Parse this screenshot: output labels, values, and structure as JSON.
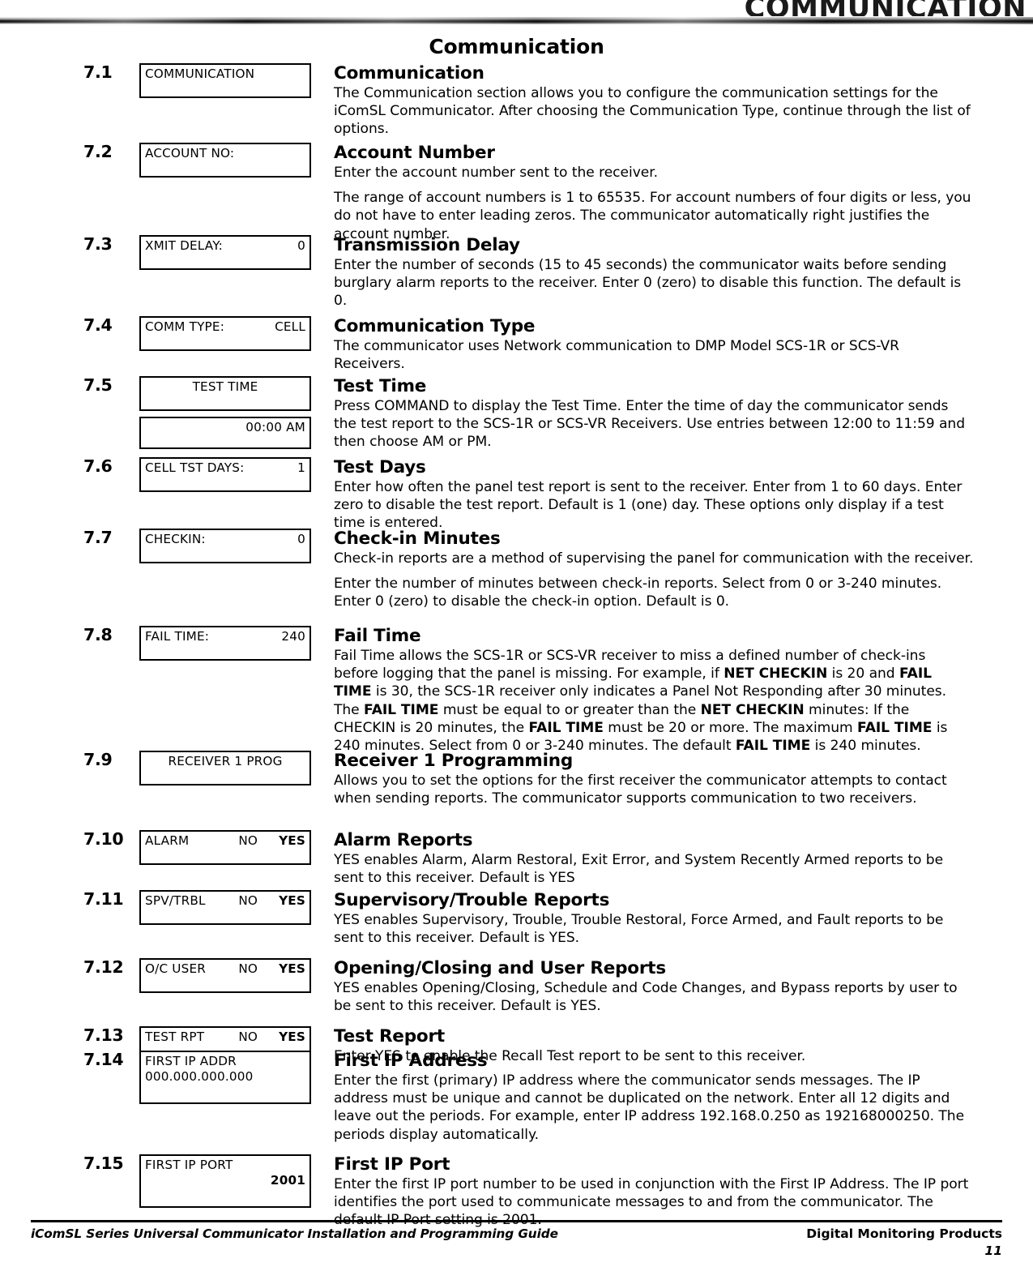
{
  "header": {
    "banner_title": "COMMUNICATION",
    "page_title": "Communication"
  },
  "sections": [
    {
      "number": "7.1",
      "heading": "Communication",
      "lcd": {
        "lines": [
          {
            "align": "left",
            "left": "COMMUNICATION",
            "right": ""
          }
        ]
      },
      "paragraphs": [
        "The Communication section allows you to configure the communication settings for the iComSL Communicator. After choosing the Communication Type, continue through the list of options."
      ]
    },
    {
      "number": "7.2",
      "heading": "Account Number",
      "lcd": {
        "lines": [
          {
            "align": "left",
            "left": "ACCOUNT NO:",
            "right": ""
          }
        ]
      },
      "paragraphs": [
        "Enter the account number sent to the receiver.",
        "The range of account numbers is 1 to 65535. For account numbers of four digits or less, you do not have to enter leading zeros. The communicator automatically right justifies the account number."
      ]
    },
    {
      "number": "7.3",
      "heading": "Transmission Delay",
      "lcd": {
        "lines": [
          {
            "align": "split",
            "left": "XMIT DELAY:",
            "right": "0"
          }
        ]
      },
      "paragraphs": [
        "Enter the number of seconds (15 to 45 seconds) the communicator waits before sending burglary alarm reports to the receiver. Enter 0 (zero) to disable this function. The default is 0."
      ]
    },
    {
      "number": "7.4",
      "heading": "Communication Type",
      "lcd": {
        "lines": [
          {
            "align": "split",
            "left": "COMM TYPE:",
            "right": "CELL"
          }
        ]
      },
      "paragraphs": [
        "The communicator uses Network communication to DMP Model SCS-1R or SCS-VR Receivers."
      ]
    },
    {
      "number": "7.5",
      "heading": "Test Time",
      "lcd": {
        "lines": [
          {
            "align": "center",
            "left": "TEST TIME",
            "right": ""
          }
        ]
      },
      "lcd2": {
        "lines": [
          {
            "align": "right",
            "left": "",
            "right": "00:00 AM"
          }
        ]
      },
      "paragraphs": [
        "Press COMMAND to display the Test Time. Enter the time of day the communicator sends the test report to the SCS-1R or SCS-VR Receivers. Use entries between 12:00 to 11:59 and then choose AM or PM."
      ]
    },
    {
      "number": "7.6",
      "heading": "Test Days",
      "lcd": {
        "lines": [
          {
            "align": "split",
            "left": "CELL TST DAYS:",
            "right": "1"
          }
        ]
      },
      "paragraphs": [
        "Enter how often the panel test report is sent to the receiver. Enter from 1 to 60 days. Enter zero to disable the test report. Default is 1 (one) day. These options only display if a test time is entered."
      ]
    },
    {
      "number": "7.7",
      "heading": "Check-in Minutes",
      "lcd": {
        "lines": [
          {
            "align": "split",
            "left": "CHECKIN:",
            "right": "0"
          }
        ]
      },
      "paragraphs": [
        "Check-in reports are a method of supervising the panel for communication with the receiver.",
        "Enter the number of minutes between check-in reports. Select from 0 or 3-240 minutes. Enter 0 (zero) to disable the check-in option. Default is 0."
      ]
    },
    {
      "number": "7.8",
      "heading": "Fail Time",
      "lcd": {
        "lines": [
          {
            "align": "split",
            "left": "FAIL TIME:",
            "right": "240"
          }
        ]
      },
      "paragraphs_rich": [
        [
          {
            "t": "Fail Time allows the SCS-1R or SCS-VR receiver to miss a defined number of check-ins before logging that the panel is missing. For example, if ",
            "b": false
          },
          {
            "t": "NET CHECKIN",
            "b": true
          },
          {
            "t": " is 20 and ",
            "b": false
          },
          {
            "t": "FAIL TIME",
            "b": true
          },
          {
            "t": " is 30, the SCS-1R receiver only indicates a Panel Not Responding after 30 minutes. The ",
            "b": false
          },
          {
            "t": "FAIL TIME",
            "b": true
          },
          {
            "t": " must be equal to or greater than the ",
            "b": false
          },
          {
            "t": "NET CHECKIN",
            "b": true
          },
          {
            "t": " minutes: If the CHECKIN is 20 minutes, the ",
            "b": false
          },
          {
            "t": "FAIL TIME",
            "b": true
          },
          {
            "t": " must be 20 or more. The maximum ",
            "b": false
          },
          {
            "t": "FAIL TIME",
            "b": true
          },
          {
            "t": " is 240 minutes. Select from 0 or 3-240 minutes. The default ",
            "b": false
          },
          {
            "t": "FAIL TIME",
            "b": true
          },
          {
            "t": " is 240 minutes.",
            "b": false
          }
        ]
      ]
    },
    {
      "number": "7.9",
      "heading": "Receiver 1 Programming",
      "lcd": {
        "lines": [
          {
            "align": "center",
            "left": "RECEIVER 1 PROG",
            "right": ""
          }
        ]
      },
      "paragraphs": [
        "Allows you to set the options for the first receiver the communicator attempts to contact when sending reports. The communicator supports communication to two receivers."
      ]
    },
    {
      "number": "7.10",
      "heading": "Alarm Reports",
      "lcd": {
        "lines": [
          {
            "align": "yesno",
            "left": "ALARM",
            "mid": "NO",
            "right": "YES"
          }
        ]
      },
      "paragraphs": [
        "YES enables Alarm, Alarm Restoral, Exit Error, and System Recently Armed reports to be sent to this receiver. Default is YES"
      ]
    },
    {
      "number": "7.11",
      "heading": "Supervisory/Trouble Reports",
      "lcd": {
        "lines": [
          {
            "align": "yesno",
            "left": "SPV/TRBL",
            "mid": "NO",
            "right": "YES"
          }
        ]
      },
      "paragraphs": [
        "YES enables Supervisory, Trouble, Trouble Restoral, Force Armed, and Fault reports to be sent to this receiver. Default is YES."
      ]
    },
    {
      "number": "7.12",
      "heading": "Opening/Closing and User Reports",
      "lcd": {
        "lines": [
          {
            "align": "yesno",
            "left": "O/C USER",
            "mid": "NO",
            "right": "YES"
          }
        ]
      },
      "paragraphs": [
        "YES enables Opening/Closing, Schedule and Code Changes, and Bypass reports by user to be sent to this receiver. Default is YES."
      ]
    },
    {
      "number": "7.13",
      "heading": "Test Report",
      "lcd": {
        "lines": [
          {
            "align": "yesno",
            "left": "TEST RPT",
            "mid": "NO",
            "right": "YES"
          }
        ]
      },
      "paragraphs": [
        "Enter YES to enable the Recall Test report to be sent to this receiver."
      ]
    },
    {
      "number": "7.14",
      "heading": "First IP Address",
      "lcd": {
        "lines": [
          {
            "align": "left",
            "left": "FIRST IP ADDR",
            "right": ""
          },
          {
            "align": "left",
            "left": "000.000.000.000",
            "right": ""
          }
        ]
      },
      "paragraphs": [
        "Enter the first (primary) IP address where the communicator sends messages. The IP address must be unique and cannot be duplicated on the network. Enter all 12 digits and leave out the periods. For example, enter IP address 192.168.0.250 as 192168000250. The periods display automatically."
      ]
    },
    {
      "number": "7.15",
      "heading": "First IP Port",
      "lcd": {
        "lines": [
          {
            "align": "left",
            "left": "FIRST IP PORT",
            "right": ""
          },
          {
            "align": "right",
            "left": "",
            "right": "2001",
            "bold": true
          }
        ]
      },
      "paragraphs": [
        "Enter the first IP port number to be used in conjunction with the First IP Address. The IP port identifies the port used to communicate messages to and from the communicator. The default IP Port setting is 2001."
      ]
    }
  ],
  "footer": {
    "left": "iComSL Series Universal Communicator Installation and Programming Guide",
    "right": "Digital Monitoring Products",
    "page_number": "11"
  }
}
